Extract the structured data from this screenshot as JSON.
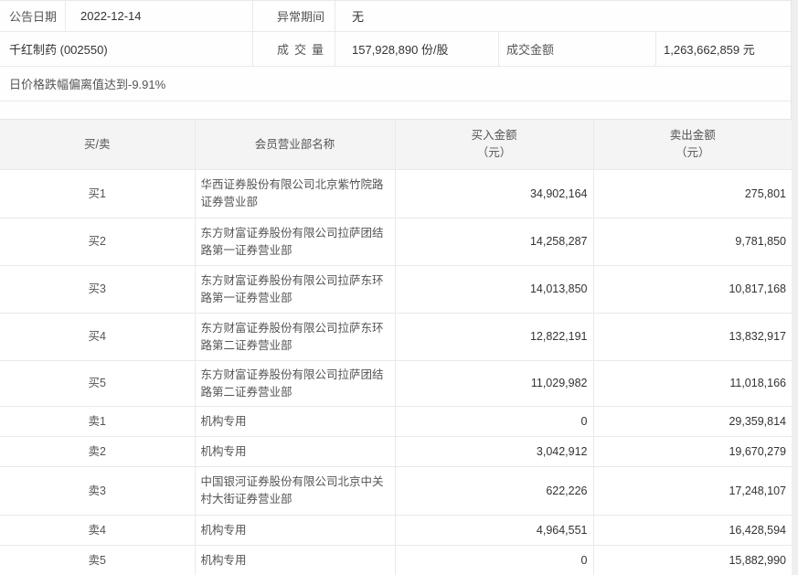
{
  "info": {
    "announce_date_label": "公告日期",
    "announce_date_value": "2022-12-14",
    "abnormal_period_label": "异常期间",
    "abnormal_period_value": "无",
    "stock_name": "千红制药 (002550)",
    "volume_label": "成交量",
    "volume_value": "157,928,890 份/股",
    "turnover_label": "成交金额",
    "turnover_value": "1,263,662,859 元",
    "reason": "日价格跌幅偏离值达到-9.91%"
  },
  "table": {
    "headers": {
      "side": "买/卖",
      "branch": "会员营业部名称",
      "buy_line1": "买入金额",
      "buy_line2": "（元）",
      "sell_line1": "卖出金额",
      "sell_line2": "（元）"
    },
    "rows": [
      {
        "side": "买1",
        "branch": "华西证券股份有限公司北京紫竹院路证券营业部",
        "buy": "34,902,164",
        "sell": "275,801"
      },
      {
        "side": "买2",
        "branch": "东方财富证券股份有限公司拉萨团结路第一证券营业部",
        "buy": "14,258,287",
        "sell": "9,781,850"
      },
      {
        "side": "买3",
        "branch": "东方财富证券股份有限公司拉萨东环路第一证券营业部",
        "buy": "14,013,850",
        "sell": "10,817,168"
      },
      {
        "side": "买4",
        "branch": "东方财富证券股份有限公司拉萨东环路第二证券营业部",
        "buy": "12,822,191",
        "sell": "13,832,917"
      },
      {
        "side": "买5",
        "branch": "东方财富证券股份有限公司拉萨团结路第二证券营业部",
        "buy": "11,029,982",
        "sell": "11,018,166"
      },
      {
        "side": "卖1",
        "branch": "机构专用",
        "buy": "0",
        "sell": "29,359,814"
      },
      {
        "side": "卖2",
        "branch": "机构专用",
        "buy": "3,042,912",
        "sell": "19,670,279"
      },
      {
        "side": "卖3",
        "branch": "中国银河证券股份有限公司北京中关村大街证券营业部",
        "buy": "622,226",
        "sell": "17,248,107"
      },
      {
        "side": "卖4",
        "branch": "机构专用",
        "buy": "4,964,551",
        "sell": "16,428,594"
      },
      {
        "side": "卖5",
        "branch": "机构专用",
        "buy": "0",
        "sell": "15,882,990"
      }
    ]
  },
  "colors": {
    "border": "#e9e9e9",
    "header_bg": "#f4f4f4",
    "page_bg": "#efefef",
    "label_text": "#555555",
    "number_text": "#333333"
  }
}
